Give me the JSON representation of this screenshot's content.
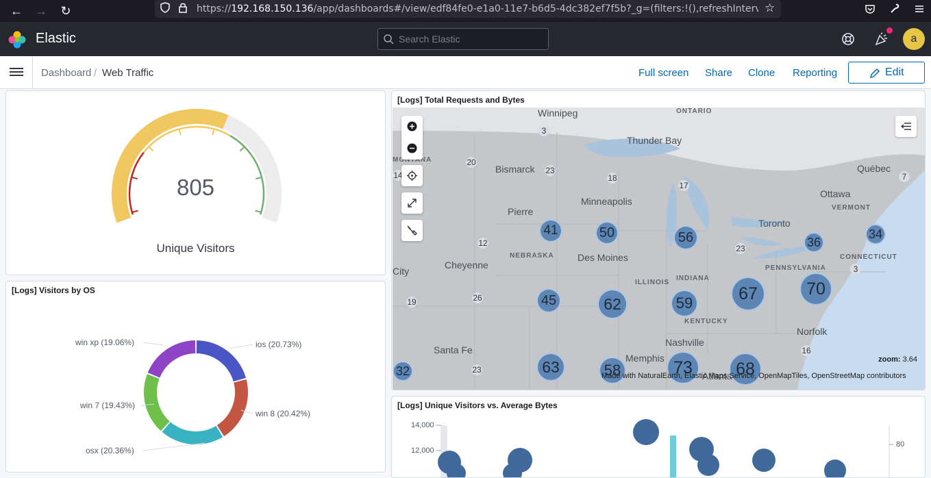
{
  "browser": {
    "url_prefix": "https://",
    "url_host": "192.168.150.136",
    "url_rest": "/app/dashboards#/view/edf84fe0-e1a0-11e7-b6d5-4dc382ef7f5b?_g=(filters:!(),refreshInterval:(pause:!f,value"
  },
  "header": {
    "brand": "Elastic",
    "search_placeholder": "Search Elastic",
    "avatar_initial": "a"
  },
  "app_bar": {
    "breadcrumb_root": "Dashboard",
    "breadcrumb_separator": "/",
    "breadcrumb_current": "Web Traffic",
    "actions": [
      "Full screen",
      "Share",
      "Clone",
      "Reporting"
    ],
    "edit_label": "Edit"
  },
  "gauge_panel": {
    "value": "805",
    "label": "Unique Visitors",
    "fill_fraction": 0.6,
    "band_colors": [
      "#bd271e",
      "#f1c85f",
      "#6db06a"
    ]
  },
  "os_panel": {
    "title": "[Logs] Visitors by OS",
    "slices": [
      {
        "label": "ios (20.73%)",
        "percent": 20.73,
        "color": "#4a56c6"
      },
      {
        "label": "win 8 (20.42%)",
        "percent": 20.42,
        "color": "#c45543"
      },
      {
        "label": "osx (20.36%)",
        "percent": 20.36,
        "color": "#39b2c4"
      },
      {
        "label": "win 7 (19.43%)",
        "percent": 19.43,
        "color": "#6ec04a"
      },
      {
        "label": "win xp (19.06%)",
        "percent": 19.06,
        "color": "#8e44c4"
      }
    ]
  },
  "map_panel": {
    "title": "[Logs] Total Requests and Bytes",
    "zoom_label": "zoom:",
    "zoom_value": "3.64",
    "attribution": "Made with NaturalEarth, Elastic Maps Service, OpenMapTiles, OpenStreetMap contributors",
    "cities": [
      "Winnipeg",
      "Thunder Bay",
      "Bismarck",
      "Pierre",
      "Minneapolis",
      "Cheyenne",
      "Des Moines",
      "City",
      "Toronto",
      "Ottawa",
      "Québec",
      "Norfolk",
      "Nashville",
      "Memphis",
      "Santa Fe",
      "Atlanta"
    ],
    "regions": [
      "ONTARIO",
      "MONTANA",
      "NEBRASKA",
      "ILLINOIS",
      "INDIANA",
      "KENTUCKY",
      "PENNSYLVANIA",
      "CONNECTICUT",
      "VERMONT"
    ],
    "small_counts": [
      "3",
      "20",
      "23",
      "18",
      "17",
      "7",
      "14",
      "12",
      "23",
      "3",
      "19",
      "26",
      "23",
      "16"
    ],
    "clusters": [
      "41",
      "50",
      "56",
      "36",
      "34",
      "45",
      "62",
      "59",
      "67",
      "70",
      "32",
      "63",
      "58",
      "73",
      "68"
    ]
  },
  "bubble_panel": {
    "title": "[Logs] Unique Visitors vs. Average Bytes",
    "y_ticks": [
      "14,000",
      "12,000"
    ],
    "right_ticks": [
      "80"
    ]
  }
}
